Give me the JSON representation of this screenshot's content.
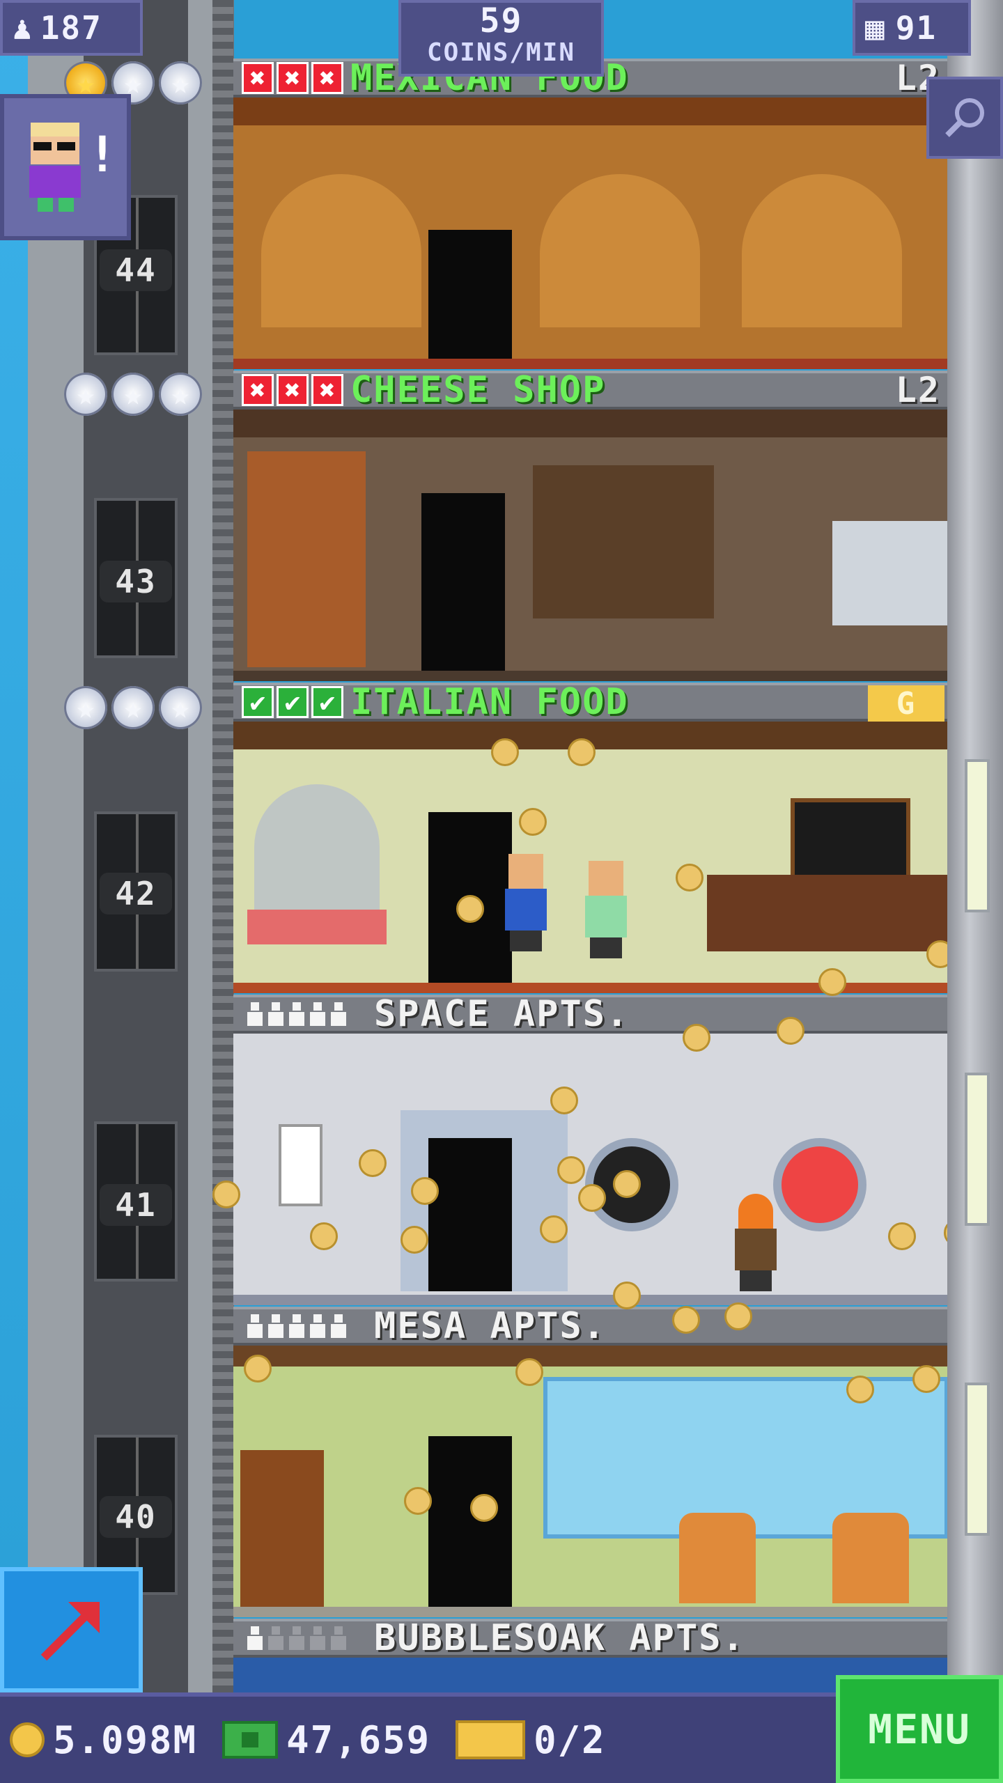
{
  "hud": {
    "population": "187",
    "coins_per_min_value": "59",
    "coins_per_min_label": "COINS/MIN",
    "floor_count": "91"
  },
  "floors": [
    {
      "number": "44",
      "name": "MEXICAN FOOD",
      "kind": "business",
      "level": "L2",
      "stars_filled": 1,
      "stock": [
        "x",
        "x",
        "x"
      ]
    },
    {
      "number": "43",
      "name": "CHEESE SHOP",
      "kind": "business",
      "level": "L2",
      "stars_filled": 0,
      "stock": [
        "x",
        "x",
        "x"
      ]
    },
    {
      "number": "42",
      "name": "ITALIAN FOOD",
      "kind": "business",
      "level": "G",
      "stars_filled": 0,
      "stock": [
        "ok",
        "ok",
        "ok"
      ]
    },
    {
      "number": "41",
      "name": "SPACE APTS.",
      "kind": "residential",
      "residents": 5,
      "capacity": 5
    },
    {
      "number": "40",
      "name": "MESA APTS.",
      "kind": "residential",
      "residents": 5,
      "capacity": 5
    },
    {
      "name": "BUBBLESOAK APTS.",
      "kind": "residential",
      "residents": 1,
      "capacity": 5
    }
  ],
  "bottom_bar": {
    "coins": "5.098M",
    "bux": "47,659",
    "tickets": "0/2",
    "menu_label": "MENU"
  },
  "icons": {
    "population": "person-icon",
    "floors": "building-icon",
    "zoom": "magnifier-icon",
    "lift": "arrow-up-right-icon",
    "coins": "coin-icon",
    "bux": "bux-icon",
    "tickets": "ticket-icon"
  },
  "colors": {
    "business_name": "#6cf05a",
    "hud_bg": "#4d4f86",
    "menu_bg": "#21b53a",
    "coin": "#ecc56a"
  }
}
